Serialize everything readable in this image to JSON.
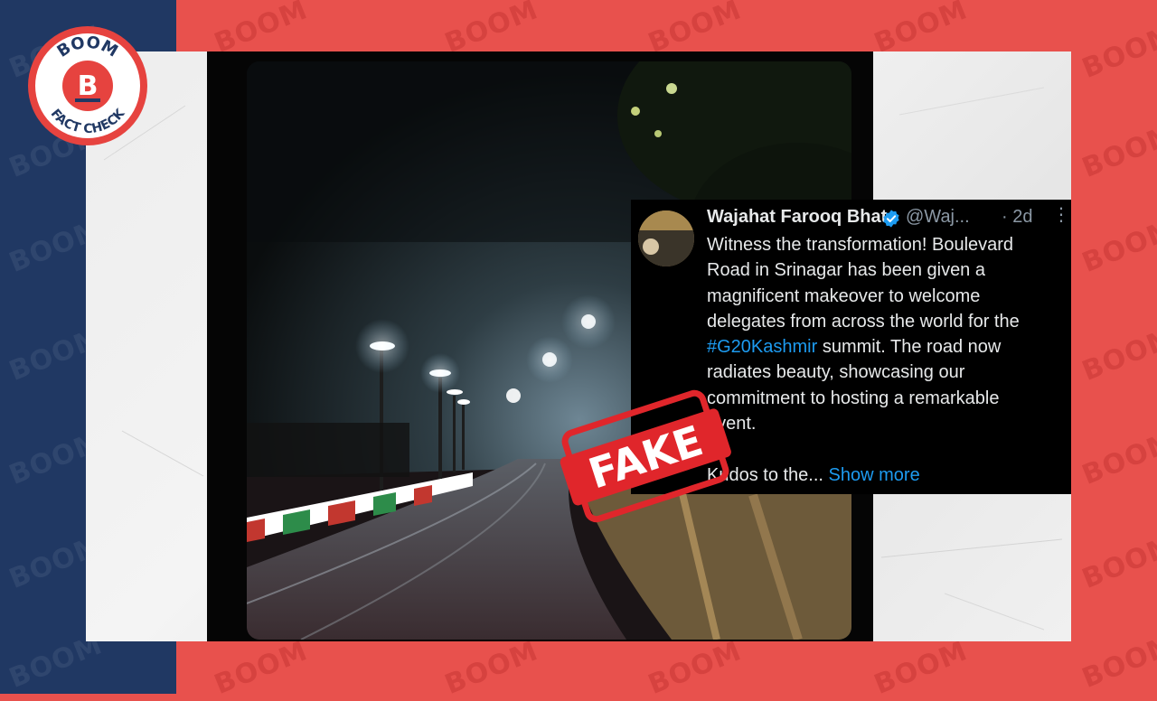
{
  "brand": {
    "logo_top": "BOOM",
    "logo_letter": "B",
    "logo_bottom": "FACT CHECK",
    "watermark": "BOOM"
  },
  "stamp": {
    "text": "FAKE"
  },
  "tweet": {
    "name": "Wajahat Farooq Bhat",
    "handle": "@Waj...",
    "time": "· 2d",
    "more": "⋮",
    "lines": [
      "Witness the transformation! Boulevard",
      "Road in Srinagar has been given a",
      "magnificent makeover to welcome",
      "delegates from across the world for the"
    ],
    "hashtag": "#G20Kashmir",
    "after_hashtag": " summit. The road now",
    "lines2": [
      "radiates beauty, showcasing our",
      "commitment to hosting a remarkable",
      "event."
    ],
    "kudos": "Kudos to the...",
    "show_more": "Show more"
  },
  "colors": {
    "navy": "#203863",
    "red": "#e8514d",
    "link": "#1d9bf0",
    "stamp_red": "#e0262b"
  }
}
